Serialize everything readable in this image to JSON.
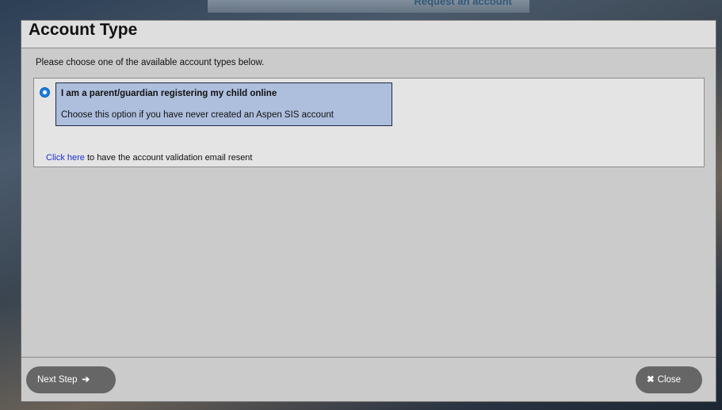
{
  "background": {
    "top_text": "Request an account"
  },
  "dialog": {
    "title": "Account Type",
    "intro": "Please choose one of the available account types below.",
    "option": {
      "title": "I am a parent/guardian registering my child online",
      "description": "Choose this option if you have never created an Aspen SIS account",
      "selected": true
    },
    "resend": {
      "link_label": "Click here",
      "text": " to have the account validation email resent"
    }
  },
  "footer": {
    "next_label": "Next Step",
    "next_icon": "arrow-right-icon",
    "close_label": "Close",
    "close_icon": "x-icon"
  },
  "colors": {
    "link": "#1f2fd0",
    "selection_bg": "#aebfde",
    "button_bg": "#666666",
    "radio": "#1a7fe0"
  }
}
